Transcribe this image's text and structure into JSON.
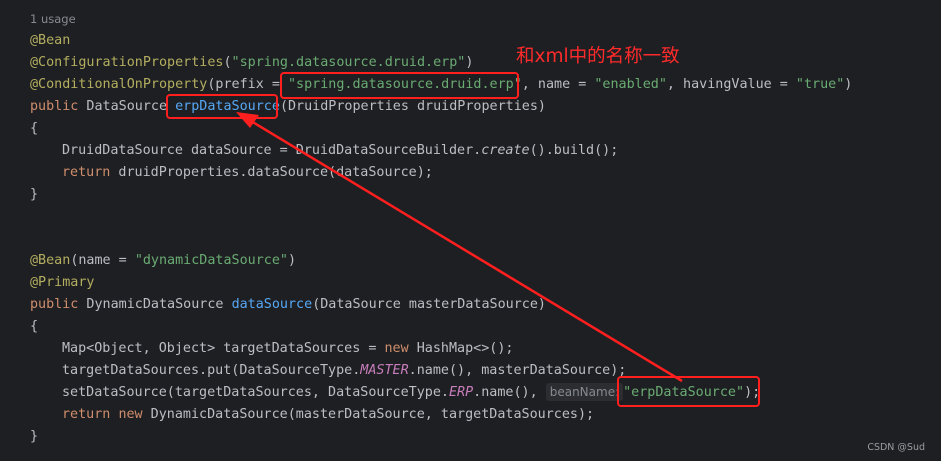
{
  "usage_hint": "1 usage",
  "code": {
    "l1": {
      "bean": "@Bean"
    },
    "l2": {
      "ann": "@ConfigurationProperties",
      "open": "(",
      "value": "\"spring.datasource.druid.erp\"",
      "close": ")"
    },
    "l3": {
      "ann": "@ConditionalOnProperty",
      "open": "(prefix = ",
      "prefix": "\"spring.datasource.druid.erp\"",
      "mid1": ", name = ",
      "name": "\"enabled\"",
      "mid2": ", havingValue = ",
      "having": "\"true\"",
      "close": ")"
    },
    "l4": {
      "kw": "public",
      "type": " DataSource ",
      "method": "erpDataSource",
      "params": "(DruidProperties druidProperties)"
    },
    "l5": {
      "text": "{"
    },
    "l6": {
      "pre": "DruidDataSource dataSource = DruidDataSourceBuilder.",
      "create": "create",
      "post": "().build();"
    },
    "l7": {
      "kw": "return",
      "rest": " druidProperties.dataSource(dataSource);"
    },
    "l8": {
      "text": "}"
    },
    "l9": {
      "ann": "@Bean",
      "open": "(name = ",
      "value": "\"dynamicDataSource\"",
      "close": ")"
    },
    "l10": {
      "ann": "@Primary"
    },
    "l11": {
      "kw": "public",
      "type": " DynamicDataSource ",
      "method": "dataSource",
      "params": "(DataSource masterDataSource)"
    },
    "l12": {
      "text": "{"
    },
    "l13": {
      "pre": "Map<Object, Object> targetDataSources = ",
      "kw": "new",
      "post": " HashMap<>();"
    },
    "l14": {
      "pre": "targetDataSources.put(DataSourceType.",
      "const": "MASTER",
      "post": ".name(), masterDataSource);"
    },
    "l15": {
      "pre": "setDataSource(targetDataSources, DataSourceType.",
      "const": "ERP",
      "post": ".name(), ",
      "hint": "beanName:",
      "value": "\"erpDataSource\"",
      "close": ");"
    },
    "l16": {
      "kw1": "return",
      "mid": " ",
      "kw2": "new",
      "post": " DynamicDataSource(masterDataSource, targetDataSources);"
    },
    "l17": {
      "text": "}"
    }
  },
  "callout_text": "和xml中的名称一致",
  "watermark": "CSDN @Sud",
  "colors": {
    "background": "#1e1f22",
    "annotation": "#b3ae60",
    "string": "#6aab73",
    "keyword": "#cf8e6d",
    "method": "#56a8f5",
    "constant": "#c77dbb",
    "highlight": "#ff1f1f"
  }
}
